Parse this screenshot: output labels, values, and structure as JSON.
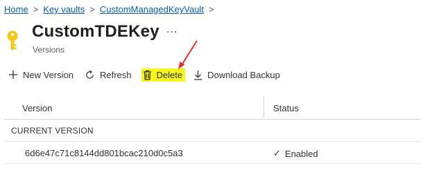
{
  "breadcrumb": {
    "items": [
      "Home",
      "Key vaults",
      "CustomManagedKeyVault"
    ],
    "separator": ">"
  },
  "header": {
    "icon": "key-icon",
    "icon_color": "#f2c811",
    "title": "CustomTDEKey",
    "subtitle": "Versions",
    "more_label": "..."
  },
  "toolbar": {
    "new_version": {
      "label": "New Version",
      "icon": "plus-icon"
    },
    "refresh": {
      "label": "Refresh",
      "icon": "refresh-icon"
    },
    "delete": {
      "label": "Delete",
      "icon": "trash-icon",
      "highlight_color": "#f6f61a"
    },
    "download_backup": {
      "label": "Download Backup",
      "icon": "download-icon"
    }
  },
  "table": {
    "columns": [
      "Version",
      "Status"
    ],
    "group_label": "CURRENT VERSION",
    "rows": [
      {
        "version": "6d6e47c71c8144dd801bcac210d0c5a3",
        "status": "Enabled",
        "status_icon": "check-icon"
      }
    ]
  },
  "annotation": {
    "type": "arrow",
    "color": "#e8302a"
  }
}
